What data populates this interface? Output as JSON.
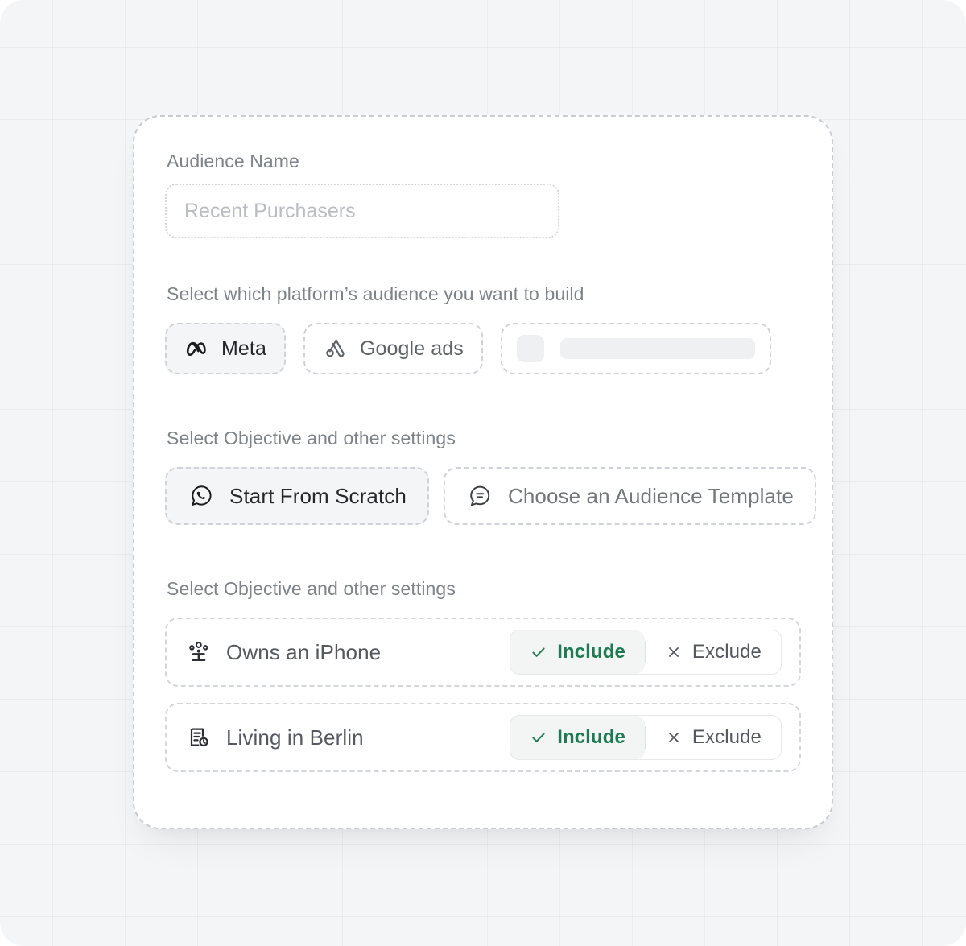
{
  "audience_name": {
    "label": "Audience Name",
    "placeholder": "Recent Purchasers",
    "value": ""
  },
  "platform_section": {
    "heading": "Select which platform’s audience you want to build",
    "options": [
      {
        "label": "Meta",
        "icon": "meta-logo-icon",
        "selected": true
      },
      {
        "label": "Google ads",
        "icon": "google-ads-logo-icon",
        "selected": false
      },
      {
        "label": "",
        "icon": "skeleton-placeholder",
        "selected": false
      }
    ]
  },
  "objective_section": {
    "heading": "Select Objective and other settings",
    "options": [
      {
        "label": "Start From Scratch",
        "icon": "whatsapp-bubble-icon",
        "selected": true
      },
      {
        "label": "Choose an Audience Template",
        "icon": "message-lines-bubble-icon",
        "selected": false
      }
    ]
  },
  "criteria_section": {
    "heading": "Select Objective and other settings",
    "include_label": "Include",
    "exclude_label": "Exclude",
    "rows": [
      {
        "label": "Owns an iPhone",
        "icon": "audience-network-icon",
        "state": "include"
      },
      {
        "label": "Living in Berlin",
        "icon": "document-clock-icon",
        "state": "include"
      }
    ]
  },
  "colors": {
    "include_green": "#1d7a52",
    "include_bg": "#f2f5f3",
    "muted_text": "#7d838b",
    "strong_text": "#24272b",
    "chip_selected_bg": "#f4f5f6",
    "dashed_border": "#cfd3d8",
    "canvas_bg": "#f4f5f6"
  }
}
